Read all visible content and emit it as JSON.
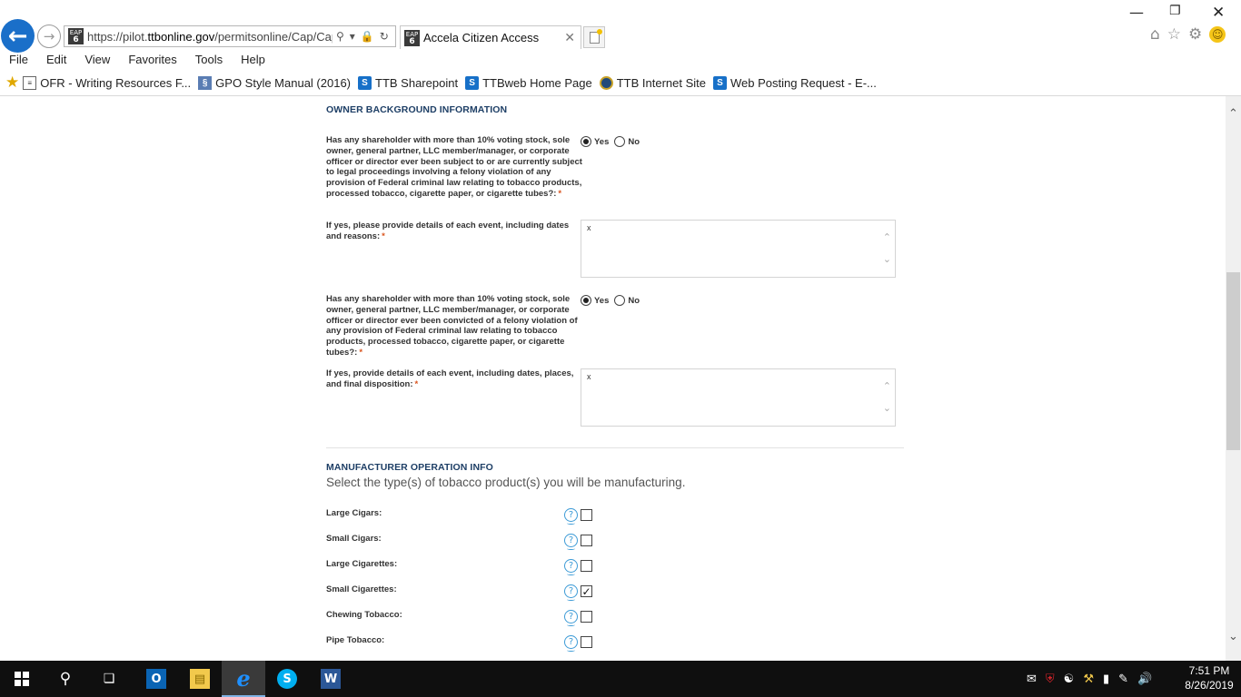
{
  "browser": {
    "url_prefix": "https://pilot.",
    "url_host": "ttbonline.gov",
    "url_path": "/permitsonline/Cap/Cap",
    "tab_title": "Accela Citizen Access",
    "eap_badge_top": "EAP",
    "eap_badge_num": "6",
    "menu": [
      "File",
      "Edit",
      "View",
      "Favorites",
      "Tools",
      "Help"
    ],
    "favorites": [
      {
        "label": "OFR - Writing Resources F...",
        "icon": "document-icon"
      },
      {
        "label": "GPO Style Manual (2016)",
        "icon": "gpo-icon"
      },
      {
        "label": "TTB Sharepoint",
        "icon": "sharepoint-icon"
      },
      {
        "label": "TTBweb Home Page",
        "icon": "sharepoint-icon"
      },
      {
        "label": "TTB Internet Site",
        "icon": "ttb-seal-icon"
      },
      {
        "label": "Web Posting Request - E-...",
        "icon": "sharepoint-icon"
      }
    ]
  },
  "form": {
    "owner_section_title": "OWNER BACKGROUND INFORMATION",
    "q1": {
      "label": "Has any shareholder with more than 10% voting stock, sole owner, general partner, LLC member/manager, or corporate officer or director ever been subject to or are currently subject to legal proceedings involving a felony violation of any provision of Federal criminal law relating to tobacco products, processed tobacco, cigarette paper, or cigarette tubes?:",
      "yes": "Yes",
      "no": "No",
      "selected": "Yes"
    },
    "q1_details": {
      "label": "If yes, please provide details of each event, including dates and reasons:",
      "value": "x"
    },
    "q2": {
      "label": "Has any shareholder with more than 10% voting stock, sole owner, general partner, LLC member/manager, or corporate officer or director ever been convicted of a felony violation of any provision of Federal criminal law relating to tobacco products, processed tobacco, cigarette paper, or cigarette tubes?:",
      "yes": "Yes",
      "no": "No",
      "selected": "Yes"
    },
    "q2_details": {
      "label": "If yes, provide details of each event, including dates, places, and final disposition:",
      "value": "x"
    },
    "required_mark": "*",
    "mfg_section_title": "MANUFACTURER OPERATION INFO",
    "mfg_subtitle": "Select the type(s) of tobacco product(s) you will be manufacturing.",
    "products": [
      {
        "label": "Large Cigars:",
        "checked": false
      },
      {
        "label": "Small Cigars:",
        "checked": false
      },
      {
        "label": "Large Cigarettes:",
        "checked": false
      },
      {
        "label": "Small Cigarettes:",
        "checked": true
      },
      {
        "label": "Chewing Tobacco:",
        "checked": false
      },
      {
        "label": "Pipe Tobacco:",
        "checked": false
      }
    ],
    "help_glyph": "?",
    "check_glyph": "✓"
  },
  "taskbar": {
    "time": "7:51 PM",
    "date": "8/26/2019",
    "apps": [
      "outlook-icon",
      "file-explorer-icon",
      "internet-explorer-icon",
      "skype-icon",
      "word-icon"
    ]
  },
  "colors": {
    "section_title": "#1e3f66",
    "required": "#d9541e",
    "help_icon": "#3b9ad6",
    "taskbar": "#0f0f0f"
  }
}
